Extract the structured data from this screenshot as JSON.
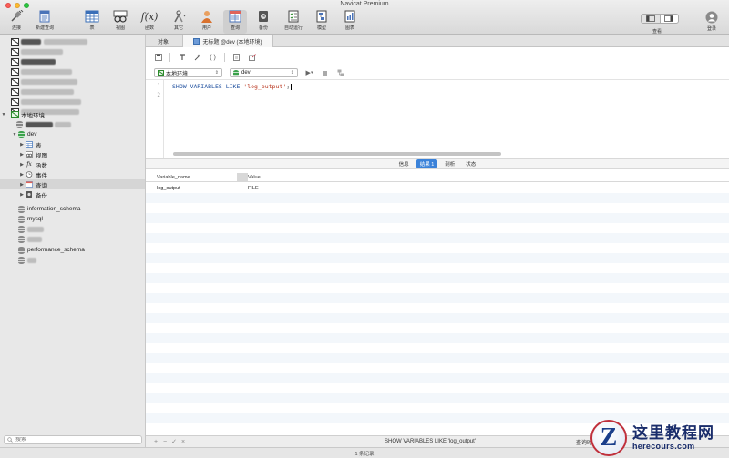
{
  "window": {
    "title": "Navicat Premium"
  },
  "toolbar": {
    "items": [
      {
        "label": "连接",
        "icon": "plug-icon"
      },
      {
        "label": "新建查询",
        "icon": "new-query-icon"
      },
      {
        "label": "表",
        "icon": "table-icon"
      },
      {
        "label": "视图",
        "icon": "view-icon"
      },
      {
        "label": "函数",
        "icon": "function-icon"
      },
      {
        "label": "其它",
        "icon": "tools-icon"
      },
      {
        "label": "用户",
        "icon": "user-icon"
      },
      {
        "label": "查询",
        "icon": "query-icon"
      },
      {
        "label": "备份",
        "icon": "backup-icon"
      },
      {
        "label": "自动运行",
        "icon": "automation-icon"
      },
      {
        "label": "模型",
        "icon": "model-icon"
      },
      {
        "label": "图表",
        "icon": "chart-icon"
      }
    ],
    "view_label": "查看",
    "login_label": "登录"
  },
  "sidebar": {
    "connections_blurred": 9,
    "local_connection": "本地环境",
    "database": "dev",
    "children": [
      {
        "label": "表",
        "icon": "table-icon"
      },
      {
        "label": "视图",
        "icon": "view-icon"
      },
      {
        "label": "函数",
        "icon": "function-icon"
      },
      {
        "label": "事件",
        "icon": "clock-icon"
      },
      {
        "label": "查询",
        "icon": "query-icon"
      },
      {
        "label": "备份",
        "icon": "backup-icon"
      }
    ],
    "other_dbs": [
      "information_schema",
      "mysql",
      "",
      "",
      "performance_schema",
      ""
    ],
    "search_placeholder": "搜索"
  },
  "tabs": {
    "objects": "对象",
    "query": "无标题 @dev (本地环境)"
  },
  "query": {
    "connection": "本地环境",
    "database": "dev",
    "sql_keyword": "SHOW VARIABLES LIKE ",
    "sql_string": "'log_output'",
    "sql_end": ";",
    "line_numbers": [
      "1",
      "2"
    ]
  },
  "result_tabs": [
    {
      "label": "信息",
      "active": false
    },
    {
      "label": "结果 1",
      "active": true
    },
    {
      "label": "剖析",
      "active": false
    },
    {
      "label": "状态",
      "active": false
    }
  ],
  "grid": {
    "columns": [
      "Variable_name",
      "Value"
    ],
    "rows": [
      [
        "log_output",
        "FILE"
      ]
    ]
  },
  "bottom_bar": {
    "query_text": "SHOW VARIABLES LIKE 'log_output'",
    "right_text": "查询时"
  },
  "status": {
    "records": "1 条记录"
  },
  "watermark": {
    "title": "这里教程网",
    "subtitle": "herecours.com"
  }
}
